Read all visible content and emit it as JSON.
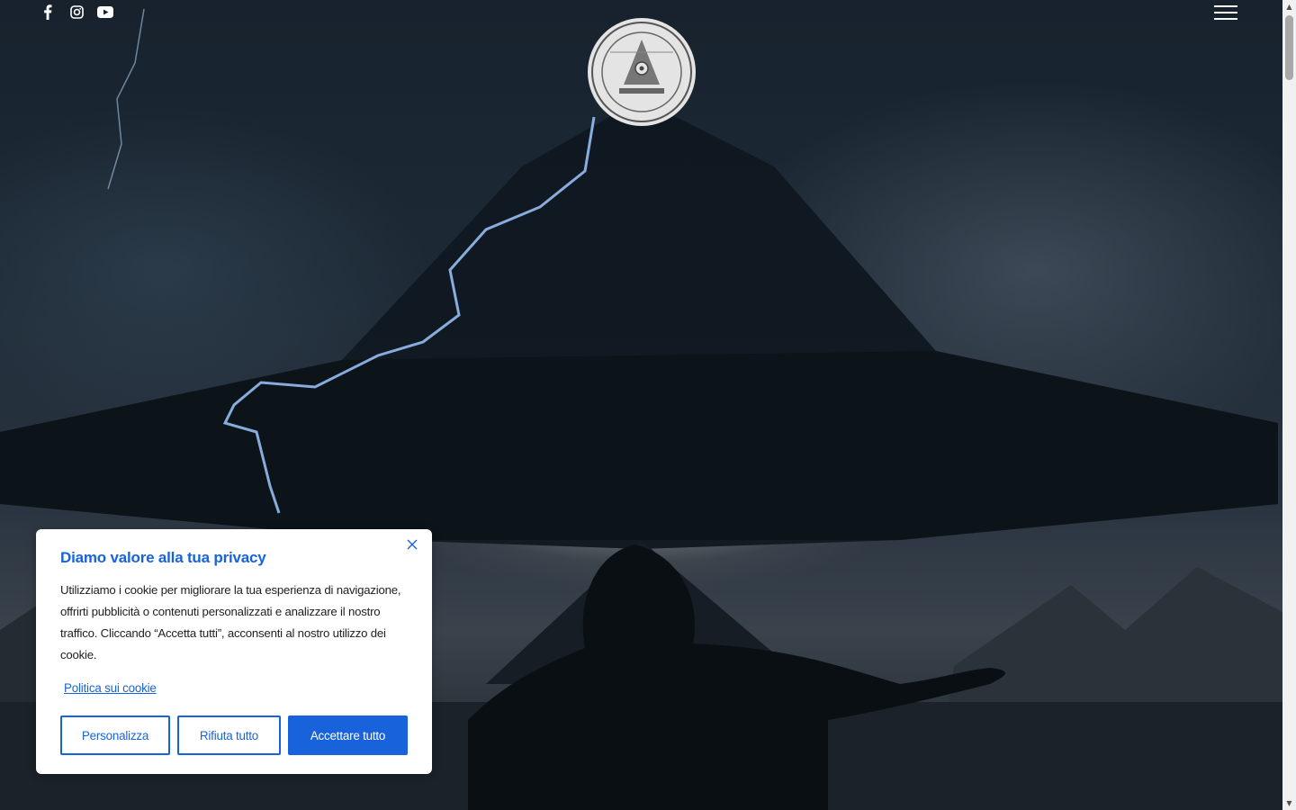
{
  "header": {
    "social": [
      {
        "icon": "facebook-icon"
      },
      {
        "icon": "instagram-icon"
      },
      {
        "icon": "youtube-icon"
      }
    ],
    "menu_icon": "hamburger-menu-icon",
    "logo_icon": "circular-seal-logo"
  },
  "cookie_banner": {
    "title": "Diamo valore alla tua privacy",
    "message": "Utilizziamo i cookie per migliorare la tua esperienza di navigazione, offrirti pubblicità o contenuti personalizzati e analizzare il nostro traffico. Cliccando “Accetta tutti”, acconsenti al nostro utilizzo dei cookie.",
    "policy_link": "Politica sui cookie",
    "buttons": {
      "customize": "Personalizza",
      "reject": "Rifiuta tutto",
      "accept": "Accettare tutto"
    },
    "accent_color": "#1863dc"
  }
}
